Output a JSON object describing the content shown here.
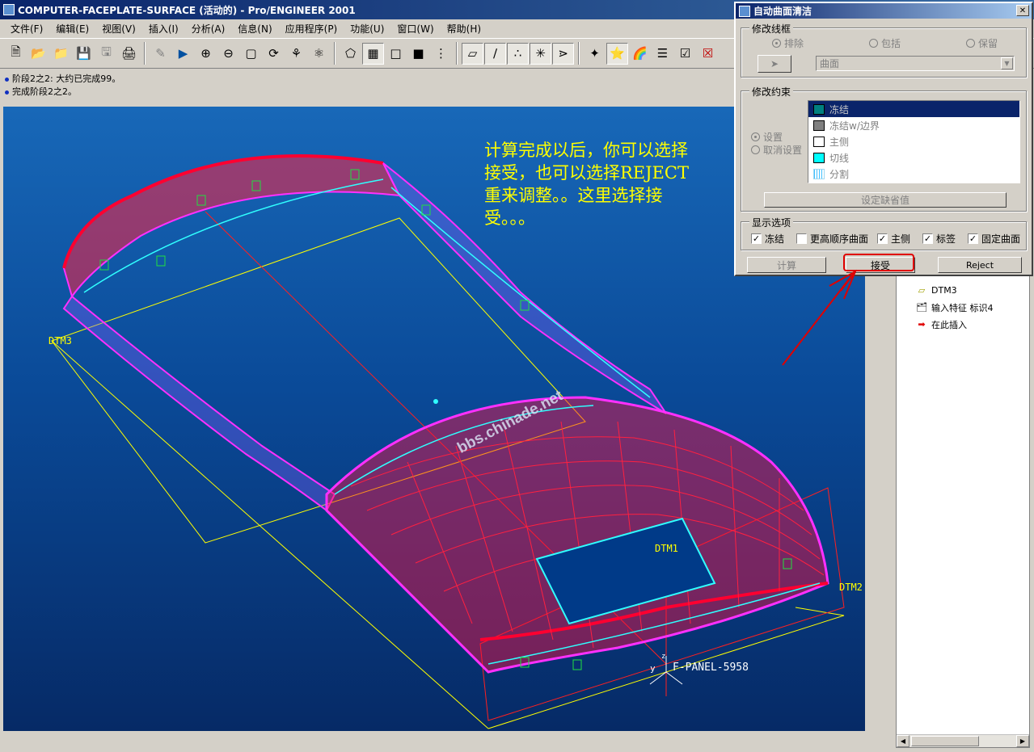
{
  "window": {
    "title": "COMPUTER-FACEPLATE-SURFACE (活动的) - Pro/ENGINEER 2001"
  },
  "menu": [
    "文件(F)",
    "编辑(E)",
    "视图(V)",
    "插入(I)",
    "分析(A)",
    "信息(N)",
    "应用程序(P)",
    "功能(U)",
    "窗口(W)",
    "帮助(H)"
  ],
  "toolbar_icons": [
    "new-icon",
    "open-icon",
    "folder-icon",
    "save-icon",
    "save-copy-icon",
    "print-icon",
    "sketch-icon",
    "play-icon",
    "zoom-in-icon",
    "zoom-out-icon",
    "zoom-fit-icon",
    "orient-icon",
    "spin-icon",
    "appearance-icon",
    "wireframe-icon",
    "hidden-line-icon",
    "no-hidden-icon",
    "shading-icon",
    "model-tree-icon",
    "datum-plane-icon",
    "datum-axis-icon",
    "datum-point-icon",
    "datum-csys-icon",
    "spin-center-icon",
    "select-icon",
    "query-icon",
    "color-icon",
    "layers-icon",
    "check-icon",
    "close-icon"
  ],
  "messages": [
    "阶段2之2: 大约已完成99。",
    "完成阶段2之2。"
  ],
  "viewport": {
    "annotation": "计算完成以后，你可以选择接受，也可以选择REJECT重来调整。。这里选择接受。。。",
    "watermark": "bbs.chinade.net",
    "datum_labels": {
      "dtm3": "DTM3",
      "dtm1": "DTM1",
      "dtm2": "DTM2",
      "csys": "F-PANEL-5958",
      "axis_y": "y",
      "axis_z": "z"
    },
    "colors": {
      "mesh_red": "#ff0030",
      "mesh_magenta": "#ff30ff",
      "mesh_cyan": "#30ffff",
      "datum_yellow": "#ffff00",
      "surface_green": "#20c040"
    }
  },
  "model_tree": {
    "items": [
      {
        "label": "DTM3",
        "icon": "datum-plane-icon"
      },
      {
        "label": "输入特征 标识4",
        "icon": "import-feature-icon"
      },
      {
        "label": "在此插入",
        "icon": "insert-here-arrow-icon"
      }
    ]
  },
  "dialog": {
    "title": "自动曲面清洁",
    "wireframe_group": {
      "label": "修改线框",
      "radios": [
        "排除",
        "包括",
        "保留"
      ],
      "selected": "排除",
      "select_value": "曲面"
    },
    "constraints_group": {
      "label": "修改约束",
      "radios": [
        "设置",
        "取消设置"
      ],
      "selected": "设置",
      "list": [
        {
          "label": "冻结",
          "color": "#008080",
          "selected": true
        },
        {
          "label": "冻结w/边界",
          "color": "#808080",
          "selected": false
        },
        {
          "label": "主侧",
          "color": "#ffffff",
          "selected": false
        },
        {
          "label": "切线",
          "color": "#00ffff",
          "selected": false
        },
        {
          "label": "分割",
          "color": "#a0e0ff",
          "selected": false
        }
      ],
      "default_button": "设定缺省值"
    },
    "display_group": {
      "label": "显示选项",
      "checks": [
        {
          "label": "冻结",
          "checked": true
        },
        {
          "label": "更高顺序曲面",
          "checked": false
        },
        {
          "label": "主侧",
          "checked": true
        },
        {
          "label": "标签",
          "checked": true
        },
        {
          "label": "固定曲面",
          "checked": true
        }
      ]
    },
    "buttons": {
      "compute": "计算",
      "accept": "接受",
      "reject": "Reject"
    }
  }
}
